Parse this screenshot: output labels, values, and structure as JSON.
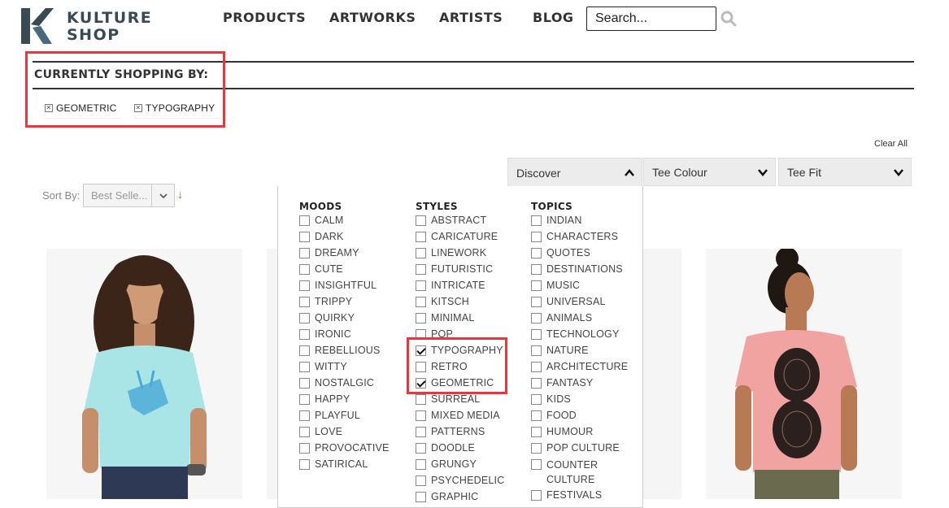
{
  "header": {
    "logo_line1": "KULTURE",
    "logo_line2": "SHOP",
    "nav": [
      "PRODUCTS",
      "ARTWORKS",
      "ARTISTS",
      "BLOG"
    ],
    "search_placeholder": "Search..."
  },
  "currently_shopping": {
    "title": "CURRENTLY SHOPPING BY:",
    "filters": [
      "GEOMETRIC",
      "TYPOGRAPHY"
    ]
  },
  "filters_bar": {
    "clear_all": "Clear All",
    "discover": "Discover",
    "tee_colour": "Tee Colour",
    "tee_fit": "Tee Fit"
  },
  "sort": {
    "label": "Sort By:",
    "selected": "Best Selle..."
  },
  "discover_panel": {
    "moods": {
      "title": "MOODS",
      "items": [
        "CALM",
        "DARK",
        "DREAMY",
        "CUTE",
        "INSIGHTFUL",
        "TRIPPY",
        "QUIRKY",
        "IRONIC",
        "REBELLIOUS",
        "WITTY",
        "NOSTALGIC",
        "HAPPY",
        "PLAYFUL",
        "LOVE",
        "PROVOCATIVE",
        "SATIRICAL"
      ]
    },
    "styles": {
      "title": "STYLES",
      "items": [
        "ABSTRACT",
        "CARICATURE",
        "LINEWORK",
        "FUTURISTIC",
        "INTRICATE",
        "KITSCH",
        "MINIMAL",
        "POP",
        "TYPOGRAPHY",
        "RETRO",
        "GEOMETRIC",
        "SURREAL",
        "MIXED MEDIA",
        "PATTERNS",
        "DOODLE",
        "GRUNGY",
        "PSYCHEDELIC",
        "GRAPHIC"
      ],
      "checked": [
        "TYPOGRAPHY",
        "GEOMETRIC"
      ]
    },
    "topics": {
      "title": "TOPICS",
      "items": [
        "INDIAN",
        "CHARACTERS",
        "QUOTES",
        "DESTINATIONS",
        "MUSIC",
        "UNIVERSAL",
        "ANIMALS",
        "TECHNOLOGY",
        "NATURE",
        "ARCHITECTURE",
        "FANTASY",
        "KIDS",
        "FOOD",
        "HUMOUR",
        "POP CULTURE",
        "COUNTER CULTURE",
        "FESTIVALS"
      ]
    }
  },
  "colors": {
    "highlight": "#e8373e",
    "logo": "#3a4a54",
    "sort_arrow": "#c9572b",
    "tee_blue": "#a9e4e6",
    "tee_pink": "#f0a3a0"
  }
}
